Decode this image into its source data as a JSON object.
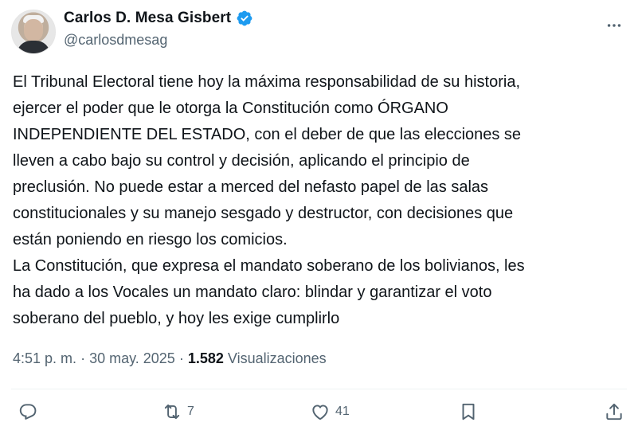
{
  "author": {
    "display_name": "Carlos D. Mesa Gisbert",
    "handle": "@carlosdmesag"
  },
  "tweet": {
    "text": "El Tribunal Electoral tiene hoy la máxima responsabilidad de su historia,\nejercer el poder que le otorga la Constitución como ÓRGANO\nINDEPENDIENTE DEL ESTADO, con el deber de que las elecciones se\nlleven a cabo bajo su control y decisión, aplicando el principio de\npreclusión. No puede estar a merced del nefasto papel de las salas\nconstitucionales y su manejo sesgado y destructor, con decisiones que\nestán poniendo en riesgo los comicios.\nLa Constitución, que expresa el mandato soberano de los bolivianos, les\nha dado a los Vocales un mandato claro: blindar y garantizar el voto\nsoberano del pueblo, y hoy les exige cumplirlo",
    "time": "4:51 p. m.",
    "date": "30 may. 2025",
    "views_count": "1.582",
    "views_label": "Visualizaciones",
    "separator": "·"
  },
  "actions": {
    "reply_count": "",
    "retweet_count": "7",
    "like_count": "41"
  },
  "icons": {
    "verified": "verified-badge-icon",
    "more": "more-options-icon",
    "reply": "reply-icon",
    "retweet": "retweet-icon",
    "like": "heart-icon",
    "bookmark": "bookmark-icon",
    "share": "share-icon"
  },
  "colors": {
    "verified": "#1d9bf0",
    "secondary_text": "#536471",
    "primary_text": "#0f1419"
  }
}
